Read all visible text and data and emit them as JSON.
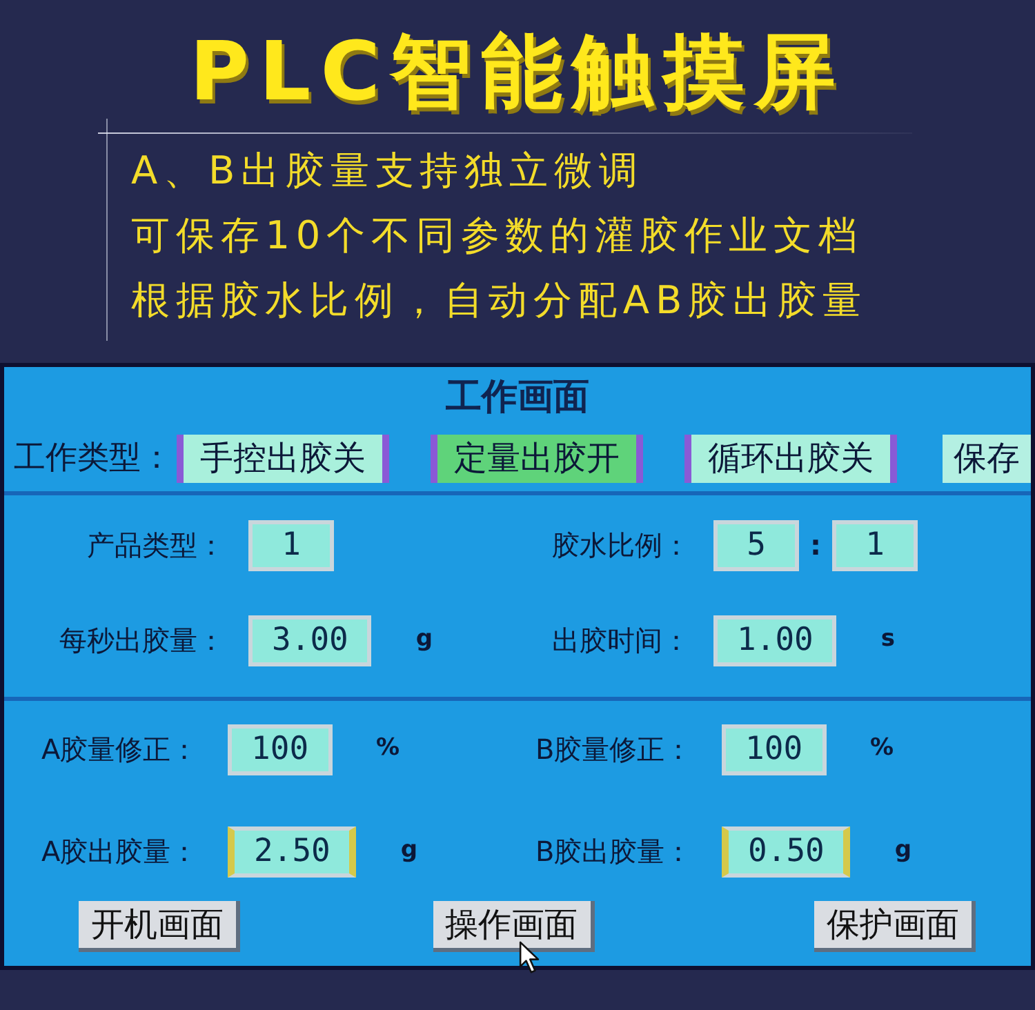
{
  "header": {
    "title": "PLC智能触摸屏",
    "features": [
      "A、B出胶量支持独立微调",
      "可保存10个不同参数的灌胶作业文档",
      "根据胶水比例，自动分配AB胶出胶量"
    ]
  },
  "screen": {
    "title": "工作画面",
    "work_type": {
      "label": "工作类型：",
      "modes": [
        {
          "label": "手控出胶关",
          "on": false
        },
        {
          "label": "定量出胶开",
          "on": true
        },
        {
          "label": "循环出胶关",
          "on": false
        }
      ],
      "save_button": "保存"
    },
    "parameters": [
      [
        {
          "label": "产品类型：",
          "fields": [
            {
              "value": "1",
              "highlighted": false
            }
          ]
        },
        {
          "label": "胶水比例：",
          "fields": [
            {
              "value": "5",
              "highlighted": false
            },
            {
              "value": "1",
              "highlighted": false
            }
          ],
          "separator": ":"
        }
      ],
      [
        {
          "label": "每秒出胶量：",
          "fields": [
            {
              "value": "3.00",
              "highlighted": false
            }
          ],
          "unit": "g"
        },
        {
          "label": "出胶时间：",
          "fields": [
            {
              "value": "1.00",
              "highlighted": false
            }
          ],
          "unit": "s"
        }
      ]
    ],
    "corrections": [
      [
        {
          "label": "A胶量修正：",
          "fields": [
            {
              "value": "100",
              "highlighted": false
            }
          ],
          "unit": "%"
        },
        {
          "label": "B胶量修正：",
          "fields": [
            {
              "value": "100",
              "highlighted": false
            }
          ],
          "unit": "%"
        }
      ],
      [
        {
          "label": "A胶出胶量：",
          "fields": [
            {
              "value": "2.50",
              "highlighted": true
            }
          ],
          "unit": "g"
        },
        {
          "label": "B胶出胶量：",
          "fields": [
            {
              "value": "0.50",
              "highlighted": true
            }
          ],
          "unit": "g"
        }
      ]
    ],
    "nav_buttons": [
      {
        "label": "开机画面",
        "pointer": false
      },
      {
        "label": "操作画面",
        "pointer": true
      },
      {
        "label": "保护画面",
        "pointer": false
      }
    ]
  }
}
